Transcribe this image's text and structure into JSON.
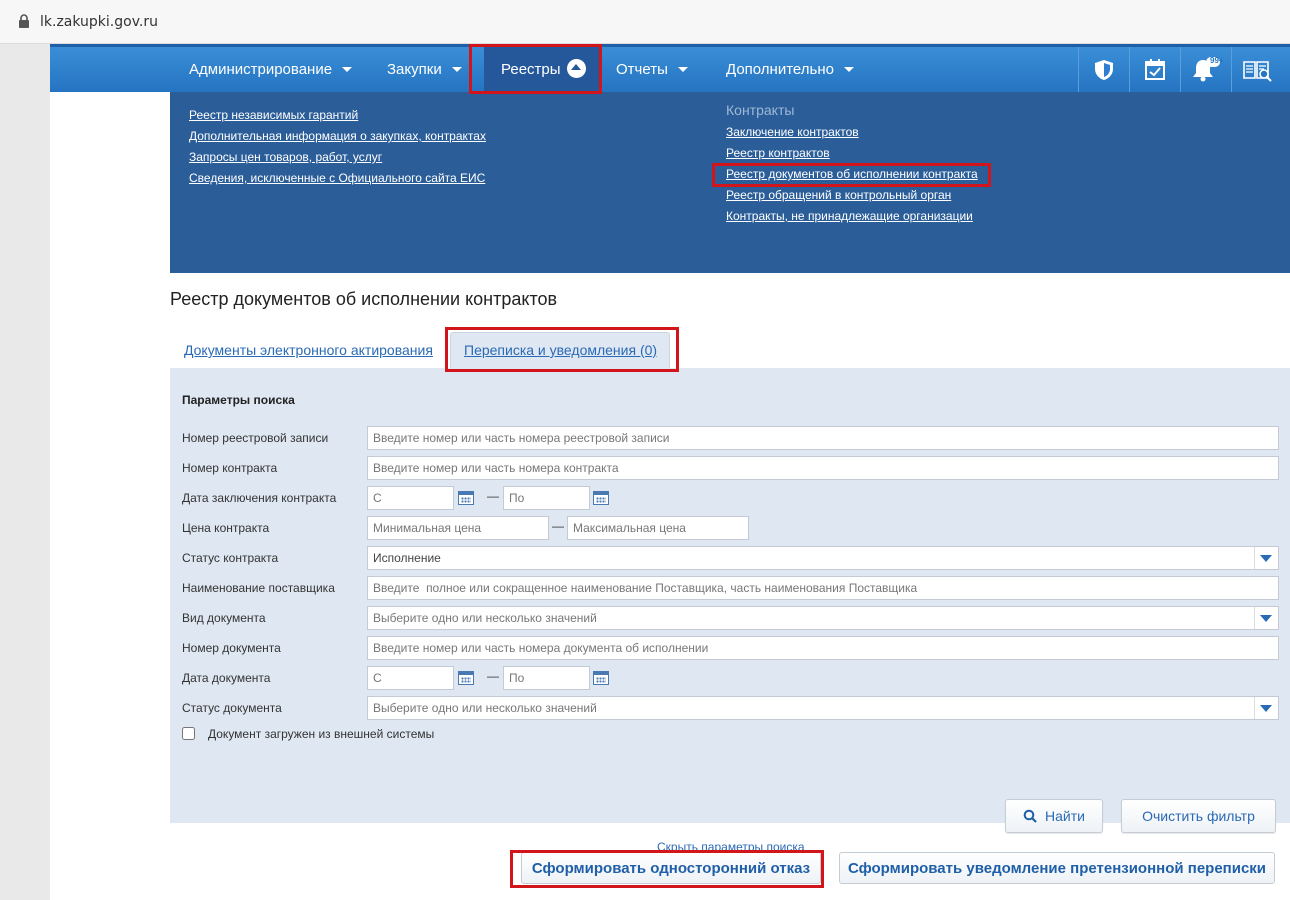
{
  "browser": {
    "url": "lk.zakupki.gov.ru"
  },
  "nav": {
    "items": [
      {
        "label": "Администрирование"
      },
      {
        "label": "Закупки"
      },
      {
        "label": "Реестры"
      },
      {
        "label": "Отчеты"
      },
      {
        "label": "Дополнительно"
      }
    ],
    "icons": [
      "shield-icon",
      "calendar-check-icon",
      "bell-icon",
      "book-search-icon"
    ],
    "bell_badge": "99+"
  },
  "dropdown": {
    "left_links": [
      "Реестр независимых гарантий",
      "Дополнительная информация о закупках, контрактах",
      "Запросы цен товаров, работ, услуг",
      "Сведения, исключенные с Официального сайта ЕИС"
    ],
    "contracts_heading": "Контракты",
    "right_links": [
      "Заключение контрактов",
      "Реестр контрактов",
      "Реестр документов об исполнении контракта",
      "Реестр обращений в контрольный орган",
      "Контракты, не принадлежащие организации"
    ]
  },
  "page_title": "Реестр документов об исполнении контрактов",
  "tabs": [
    {
      "label": "Документы электронного актирования"
    },
    {
      "label": "Переписка и уведомления (0)"
    }
  ],
  "search": {
    "title": "Параметры поиска",
    "fields": {
      "registry_number": {
        "label": "Номер реестровой записи",
        "placeholder": "Введите номер или часть номера реестровой записи"
      },
      "contract_number": {
        "label": "Номер контракта",
        "placeholder": "Введите номер или часть номера контракта"
      },
      "contract_date": {
        "label": "Дата заключения контракта",
        "from": "С",
        "to": "По"
      },
      "contract_price": {
        "label": "Цена контракта",
        "min": "Минимальная цена",
        "max": "Максимальная цена"
      },
      "contract_status": {
        "label": "Статус контракта",
        "value": "Исполнение"
      },
      "supplier_name": {
        "label": "Наименование поставщика",
        "placeholder": "Введите  полное или сокращенное наименование Поставщика, часть наименования Поставщика"
      },
      "doc_type": {
        "label": "Вид документа",
        "placeholder": "Выберите одно или несколько значений"
      },
      "doc_number": {
        "label": "Номер документа",
        "placeholder": "Введите номер или часть номера документа об исполнении"
      },
      "doc_date": {
        "label": "Дата документа",
        "from": "С",
        "to": "По"
      },
      "doc_status": {
        "label": "Статус документа",
        "placeholder": "Выберите одно или несколько значений"
      }
    },
    "external_checkbox": "Документ загружен из внешней системы",
    "find_button": "Найти",
    "clear_button": "Очистить фильтр",
    "hide_link": "Скрыть параметры поиска"
  },
  "actions": {
    "refusal_button": "Сформировать односторонний отказ",
    "claim_button": "Сформировать уведомление претензионной переписки"
  },
  "colors": {
    "nav_blue": "#2574c2",
    "dropdown_blue": "#2b5e99",
    "panel_bg": "#dfe8f2",
    "highlight_red": "#d2141b"
  }
}
